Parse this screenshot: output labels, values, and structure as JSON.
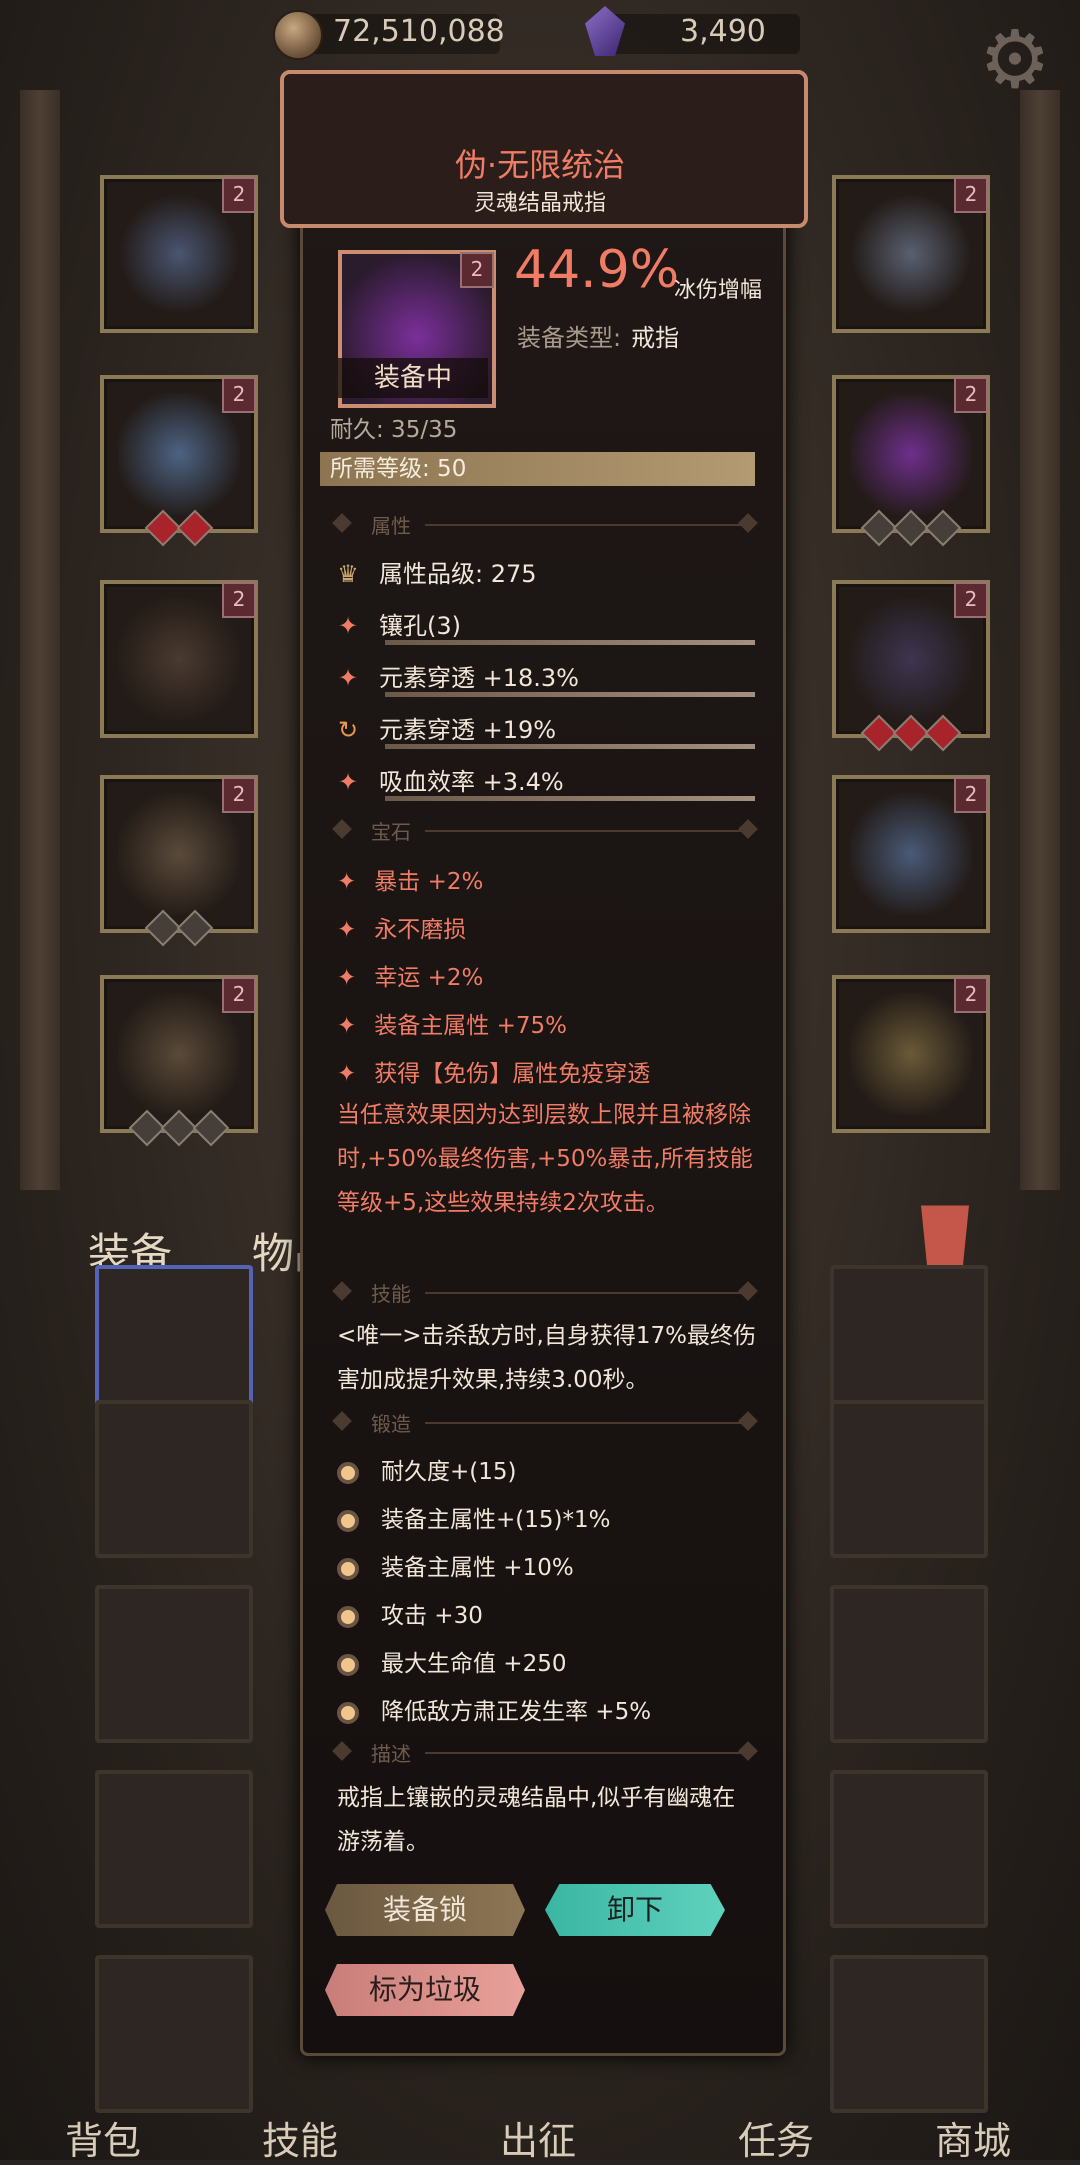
{
  "currency": {
    "gold": "72,510,088",
    "crystal": "3,490"
  },
  "tabs": {
    "equip": "装备",
    "items": "物品"
  },
  "nav": [
    "背包",
    "技能",
    "出征",
    "任务",
    "商城"
  ],
  "slot_tag": "2",
  "item": {
    "name": "伪·无限统治",
    "subtitle": "灵魂结晶戒指",
    "equipped_label": "装备中",
    "stat_pct": "44.9%",
    "stat_label": "冰伤增幅",
    "type_key": "装备类型:",
    "type_value": "戒指",
    "durability": "耐久: 35/35",
    "req_level": "所需等级: 50"
  },
  "sections": {
    "attr": "属性",
    "gem": "宝石",
    "skill": "技能",
    "forge": "锻造",
    "desc": "描述"
  },
  "attributes": [
    {
      "icon": "♛",
      "text": "属性品级: 275"
    },
    {
      "icon": "✦",
      "text": "镶孔(3)"
    },
    {
      "icon": "✦",
      "text": "元素穿透 +18.3%"
    },
    {
      "icon": "↻",
      "text": "元素穿透 +19%"
    },
    {
      "icon": "✦",
      "text": "吸血效率 +3.4%"
    }
  ],
  "gems": [
    "暴击 +2%",
    "永不磨损",
    "幸运 +2%",
    "装备主属性 +75%",
    "获得【免伤】属性免疫穿透"
  ],
  "gem_effect": "当任意效果因为达到层数上限并且被移除时,+50%最终伤害,+50%暴击,所有技能等级+5,这些效果持续2次攻击。",
  "skill": "<唯一>击杀敌方时,自身获得17%最终伤害加成提升效果,持续3.00秒。",
  "forge": [
    "耐久度+(15)",
    "装备主属性+(15)*1%",
    "装备主属性 +10%",
    "攻击 +30",
    "最大生命值 +250",
    "降低敌方肃正发生率 +5%"
  ],
  "description": "戒指上镶嵌的灵魂结晶中,似乎有幽魂在游荡着。",
  "buttons": {
    "lock": "装备锁",
    "unequip": "卸下",
    "trash": "标为垃圾"
  },
  "colors": {
    "accent": "#f07c66",
    "panel": "#1a1412",
    "teal": "#4cc4b0"
  }
}
